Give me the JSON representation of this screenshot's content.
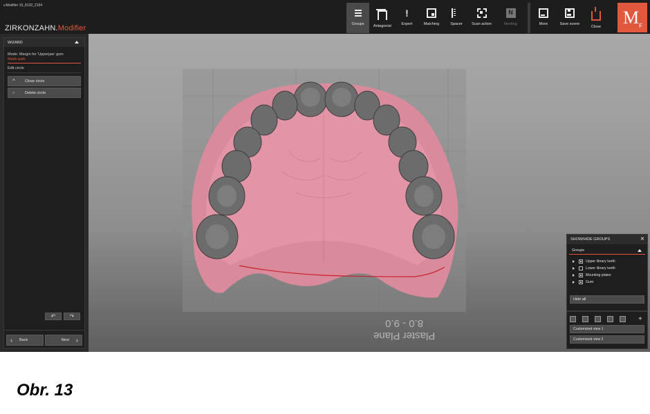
{
  "app": {
    "version": "v.Modifier 10_8132_2154",
    "brand_prefix": "ZIRKONZAHN.",
    "brand_suffix": "Modifier",
    "logo": "M",
    "logo_sub": "F"
  },
  "toolbar": {
    "groups": "Groups",
    "antagonist": "Antagonist",
    "expert": "Expert",
    "matching": "Matching",
    "spacer": "Spacer",
    "scan_action": "Scan action",
    "nesting": "Nesting",
    "nesting_icon": "N",
    "more": "More",
    "save_scene": "Save scene",
    "close": "Close"
  },
  "wizard": {
    "title": "WIZARD",
    "mode": "Mode: Margin for 'Upperjaw' gum",
    "step": "Mesh path",
    "section": "Edit circle",
    "close_circle": "Close circle",
    "delete_circle": "Delete circle",
    "back": "Back",
    "next": "Next"
  },
  "viewport": {
    "plaster_label": "Plaster Plane",
    "plaster_value": "8.0 - 9.0"
  },
  "groups_panel": {
    "title": "SHOW/HIDE GROUPS",
    "header": "Groups",
    "items": [
      {
        "label": "Upper library teeth",
        "checked": true
      },
      {
        "label": "Lower library teeth",
        "checked": false
      },
      {
        "label": "Mounting plates",
        "checked": true
      },
      {
        "label": "Gum",
        "checked": true
      }
    ],
    "hide_all": "Hide all"
  },
  "views_panel": {
    "view1": "Customized view 1",
    "view2": "Customized view 2"
  },
  "caption": "Obr. 13",
  "colors": {
    "accent": "#e2583e",
    "gum": "#d9889a",
    "teeth": "#6c6c6c",
    "margin_line": "#c8202a"
  }
}
